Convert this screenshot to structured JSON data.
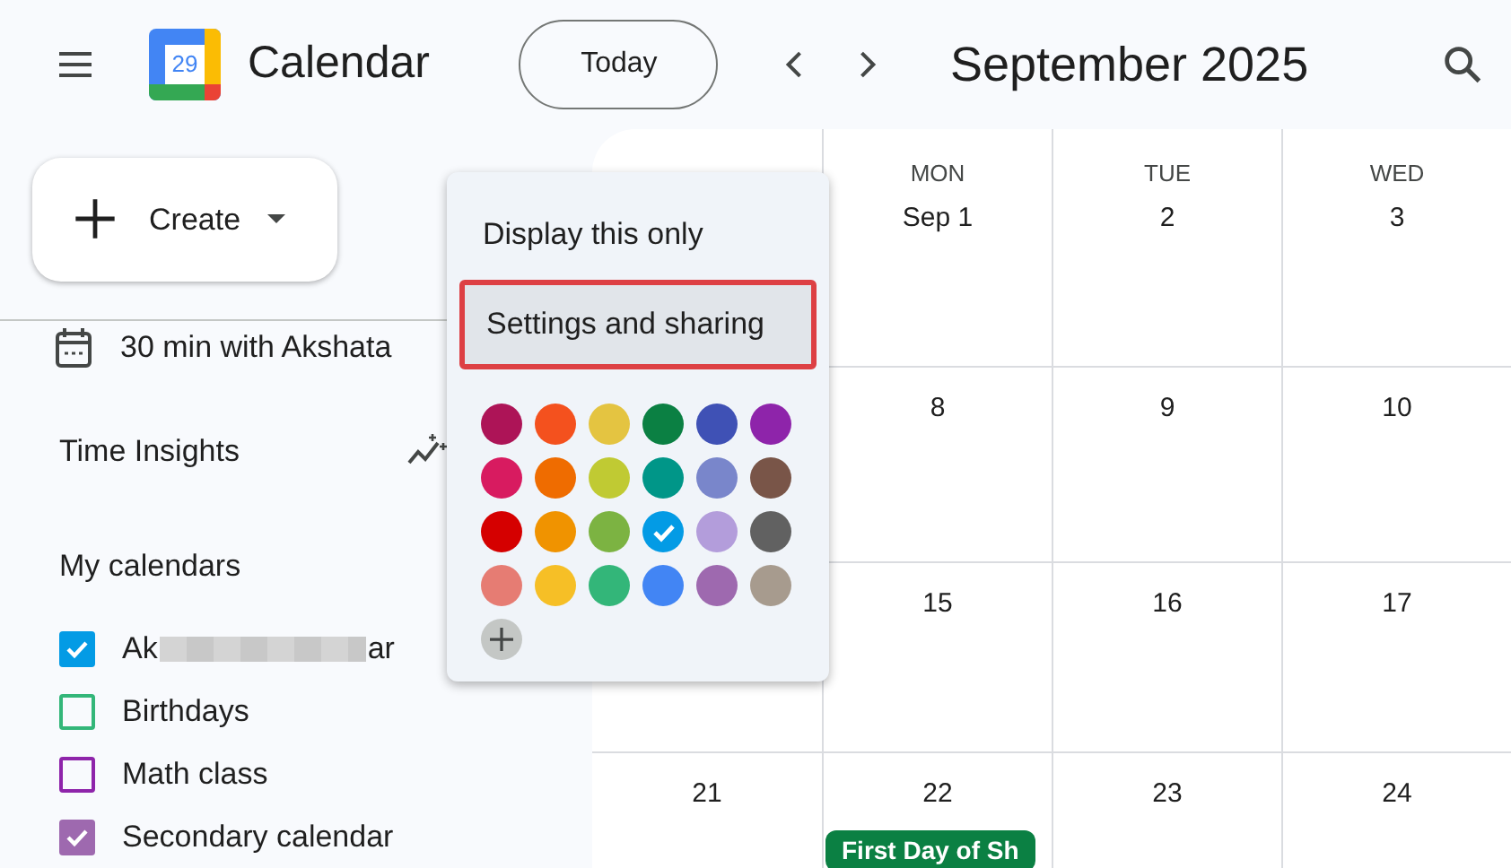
{
  "header": {
    "logo_day": "29",
    "app_name": "Calendar",
    "today_button": "Today",
    "month_title": "September 2025"
  },
  "sidebar": {
    "create_button": "Create",
    "upcoming": "30 min with Akshata",
    "time_insights": "Time Insights",
    "my_calendars": {
      "title": "My calendars",
      "items": [
        {
          "label": "Ak",
          "label_end": "ar",
          "redacted": true,
          "checked": true,
          "color": "#039be5"
        },
        {
          "label": "Birthdays",
          "checked": false,
          "color": "#33b679"
        },
        {
          "label": "Math class",
          "checked": false,
          "color": "#8e24aa"
        },
        {
          "label": "Secondary calendar",
          "checked": true,
          "color": "#9e69af"
        }
      ]
    }
  },
  "calendar": {
    "weekdays": [
      "MON",
      "TUE",
      "WED"
    ],
    "weeks": [
      {
        "days": [
          {
            "date": "Sep 1"
          },
          {
            "date": "2"
          },
          {
            "date": "3"
          }
        ]
      },
      {
        "days": [
          {
            "date": "8"
          },
          {
            "date": "9"
          },
          {
            "date": "10"
          }
        ]
      },
      {
        "days": [
          {
            "date": "15"
          },
          {
            "date": "16"
          },
          {
            "date": "17"
          }
        ]
      },
      {
        "sunday": "21",
        "days": [
          {
            "date": "22",
            "events": [
              {
                "title": "First Day of Sh",
                "color": "#0b8043"
              }
            ]
          },
          {
            "date": "23"
          },
          {
            "date": "24"
          }
        ]
      }
    ]
  },
  "menu": {
    "items": [
      {
        "label": "Display this only",
        "highlighted": false
      },
      {
        "label": "Settings and sharing",
        "highlighted": true
      }
    ],
    "colors": [
      {
        "color": "#ad1457",
        "selected": false
      },
      {
        "color": "#f4511e",
        "selected": false
      },
      {
        "color": "#e4c441",
        "selected": false
      },
      {
        "color": "#0b8043",
        "selected": false
      },
      {
        "color": "#3f51b5",
        "selected": false
      },
      {
        "color": "#8e24aa",
        "selected": false
      },
      {
        "color": "#d81b60",
        "selected": false
      },
      {
        "color": "#ef6c00",
        "selected": false
      },
      {
        "color": "#c0ca33",
        "selected": false
      },
      {
        "color": "#009688",
        "selected": false
      },
      {
        "color": "#7986cb",
        "selected": false
      },
      {
        "color": "#795548",
        "selected": false
      },
      {
        "color": "#d50000",
        "selected": false
      },
      {
        "color": "#f09300",
        "selected": false
      },
      {
        "color": "#7cb342",
        "selected": false
      },
      {
        "color": "#039be5",
        "selected": true
      },
      {
        "color": "#b39ddb",
        "selected": false
      },
      {
        "color": "#616161",
        "selected": false
      },
      {
        "color": "#e67c73",
        "selected": false
      },
      {
        "color": "#f6bf26",
        "selected": false
      },
      {
        "color": "#33b679",
        "selected": false
      },
      {
        "color": "#4285f4",
        "selected": false
      },
      {
        "color": "#9e69af",
        "selected": false
      },
      {
        "color": "#a79b8e",
        "selected": false
      }
    ]
  }
}
